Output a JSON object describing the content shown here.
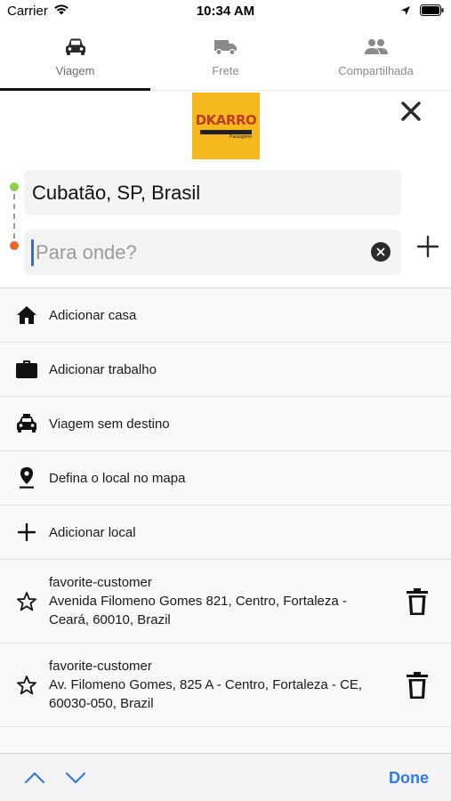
{
  "status_bar": {
    "carrier": "Carrier",
    "time": "10:34 AM",
    "icons": [
      "wifi-icon",
      "location-arrow-icon",
      "battery-icon"
    ]
  },
  "tabs": [
    {
      "label": "Viagem",
      "icon": "car-icon",
      "active": true
    },
    {
      "label": "Frete",
      "icon": "truck-icon",
      "active": false
    },
    {
      "label": "Compartilhada",
      "icon": "people-icon",
      "active": false
    }
  ],
  "logo": {
    "text": "DKARRO",
    "subtext": "Passageiro"
  },
  "route": {
    "origin_value": "Cubatão, SP, Brasil",
    "destination_placeholder": "Para onde?",
    "destination_value": ""
  },
  "shortcuts": [
    {
      "label": "Adicionar casa",
      "icon": "home-icon"
    },
    {
      "label": "Adicionar trabalho",
      "icon": "briefcase-icon"
    },
    {
      "label": "Viagem sem destino",
      "icon": "taxi-icon"
    },
    {
      "label": "Defina o local no mapa",
      "icon": "map-pin-icon"
    },
    {
      "label": "Adicionar local",
      "icon": "plus-icon"
    }
  ],
  "favorites": [
    {
      "name": "favorite-customer",
      "address": "Avenida Filomeno Gomes 821, Centro, Fortaleza - Ceará, 60010, Brazil"
    },
    {
      "name": "favorite-customer",
      "address": "Av. Filomeno Gomes, 825 A - Centro, Fortaleza - CE, 60030-050, Brazil"
    }
  ],
  "accessory": {
    "done_label": "Done"
  },
  "colors": {
    "accent_blue": "#2f7de1",
    "logo_yellow": "#f5b91d",
    "origin_dot": "#8bd14a",
    "destination_dot": "#f06425"
  }
}
